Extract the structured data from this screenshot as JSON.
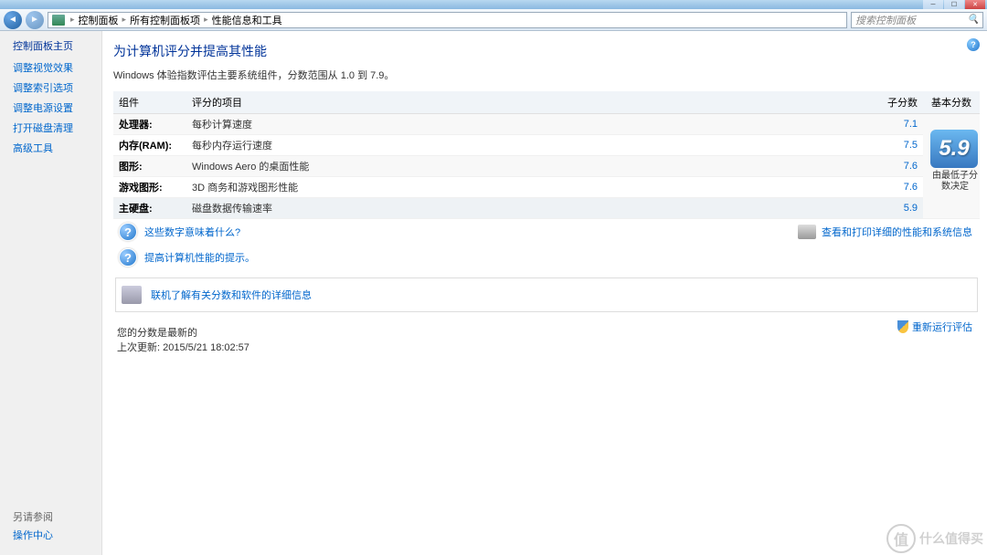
{
  "window": {
    "breadcrumb": [
      "控制面板",
      "所有控制面板项",
      "性能信息和工具"
    ],
    "search_placeholder": "搜索控制面板"
  },
  "sidebar": {
    "title": "控制面板主页",
    "links": [
      "调整视觉效果",
      "调整索引选项",
      "调整电源设置",
      "打开磁盘清理",
      "高级工具"
    ],
    "footer_label": "另请参阅",
    "footer_link": "操作中心"
  },
  "page": {
    "title": "为计算机评分并提高其性能",
    "description": "Windows 体验指数评估主要系统组件，分数范围从 1.0 到 7.9。"
  },
  "table": {
    "headers": {
      "component": "组件",
      "rated": "评分的项目",
      "subscore": "子分数",
      "base": "基本分数"
    },
    "rows": [
      {
        "component": "处理器:",
        "rated": "每秒计算速度",
        "subscore": "7.1"
      },
      {
        "component": "内存(RAM):",
        "rated": "每秒内存运行速度",
        "subscore": "7.5"
      },
      {
        "component": "图形:",
        "rated": "Windows Aero 的桌面性能",
        "subscore": "7.6"
      },
      {
        "component": "游戏图形:",
        "rated": "3D 商务和游戏图形性能",
        "subscore": "7.6"
      },
      {
        "component": "主硬盘:",
        "rated": "磁盘数据传输速率",
        "subscore": "5.9"
      }
    ]
  },
  "base_score": {
    "value": "5.9",
    "caption": "由最低子分数决定"
  },
  "links": {
    "what_mean": "这些数字意味着什么?",
    "tips": "提高计算机性能的提示。",
    "print_detail": "查看和打印详细的性能和系统信息",
    "learn_online": "联机了解有关分数和软件的详细信息"
  },
  "update": {
    "line1": "您的分数是最新的",
    "line2": "上次更新: 2015/5/21 18:02:57",
    "rerun": "重新运行评估"
  },
  "watermark": "什么值得买"
}
